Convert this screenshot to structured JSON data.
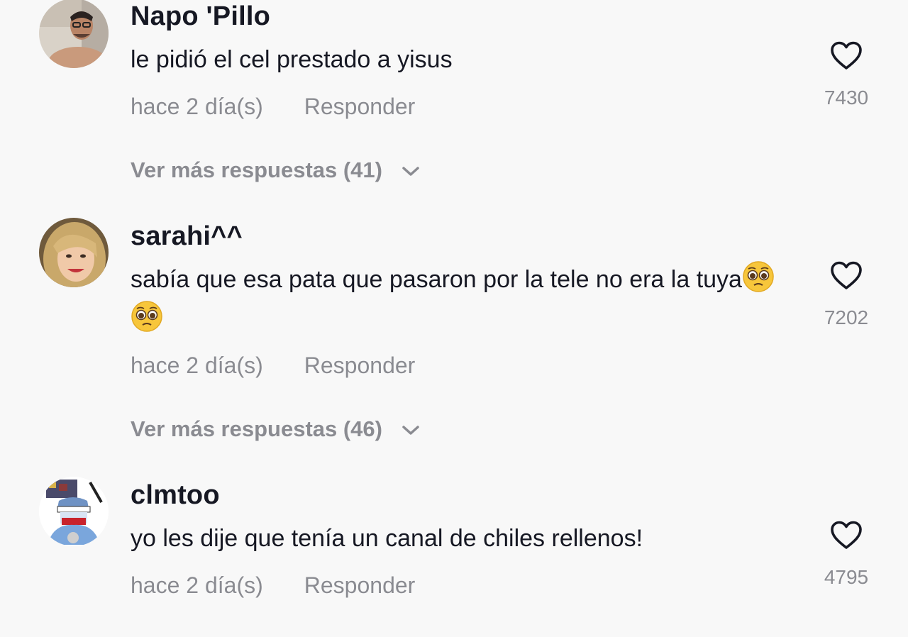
{
  "comments": [
    {
      "username": "Napo 'Pillo",
      "text": "le pidió el cel prestado a yisus",
      "time": "hace 2 día(s)",
      "reply_label": "Responder",
      "likes": "7430",
      "more_replies": "Ver más respuestas (41)",
      "avatar": "user-photo-avatar"
    },
    {
      "username": "sarahi^^",
      "text": "sabía que esa pata que pasaron por la tele no era la tuya",
      "time": "hace 2 día(s)",
      "reply_label": "Responder",
      "likes": "7202",
      "more_replies": "Ver más respuestas (46)",
      "emoji": "pleading-face-emoji",
      "avatar": "user-photo-avatar"
    },
    {
      "username": "clmtoo",
      "text": "yo les dije que tenía un canal de chiles rellenos!",
      "time": "hace 2 día(s)",
      "reply_label": "Responder",
      "likes": "4795",
      "avatar": "cartoon-avatar"
    }
  ],
  "colors": {
    "background": "#f8f8f8",
    "primary_text": "#161823",
    "secondary_text": "#8a8b91",
    "icon": "#161823"
  }
}
